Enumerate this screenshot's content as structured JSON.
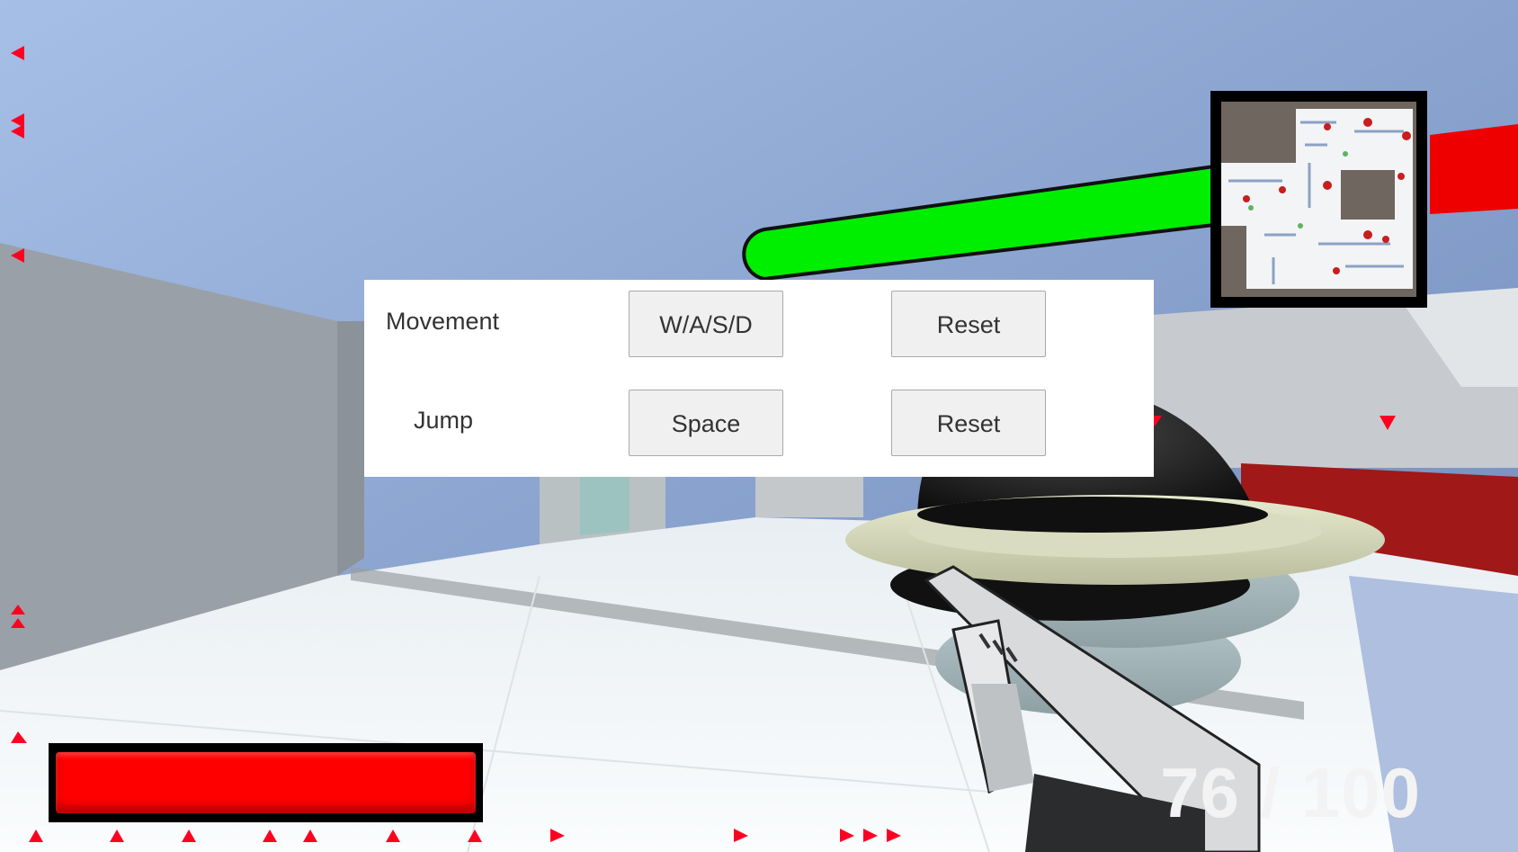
{
  "keybinds": {
    "rows": [
      {
        "action": "Movement",
        "key": "W/A/S/D",
        "reset": "Reset"
      },
      {
        "action": "Jump",
        "key": "Space",
        "reset": "Reset"
      }
    ]
  },
  "hud": {
    "ammo": "76 / 100",
    "health_fraction": 1.0,
    "enemy_health_fraction": 0.65
  },
  "colors": {
    "sky": "#8fa9d8",
    "health": "#ff0000",
    "enemy_health": "#00ee00",
    "marker": "#ff0022"
  },
  "icons": {
    "offscreen_marker": "red-triangle-icon",
    "weapon": "rifle-icon",
    "enemy": "ufo-robot-icon"
  }
}
